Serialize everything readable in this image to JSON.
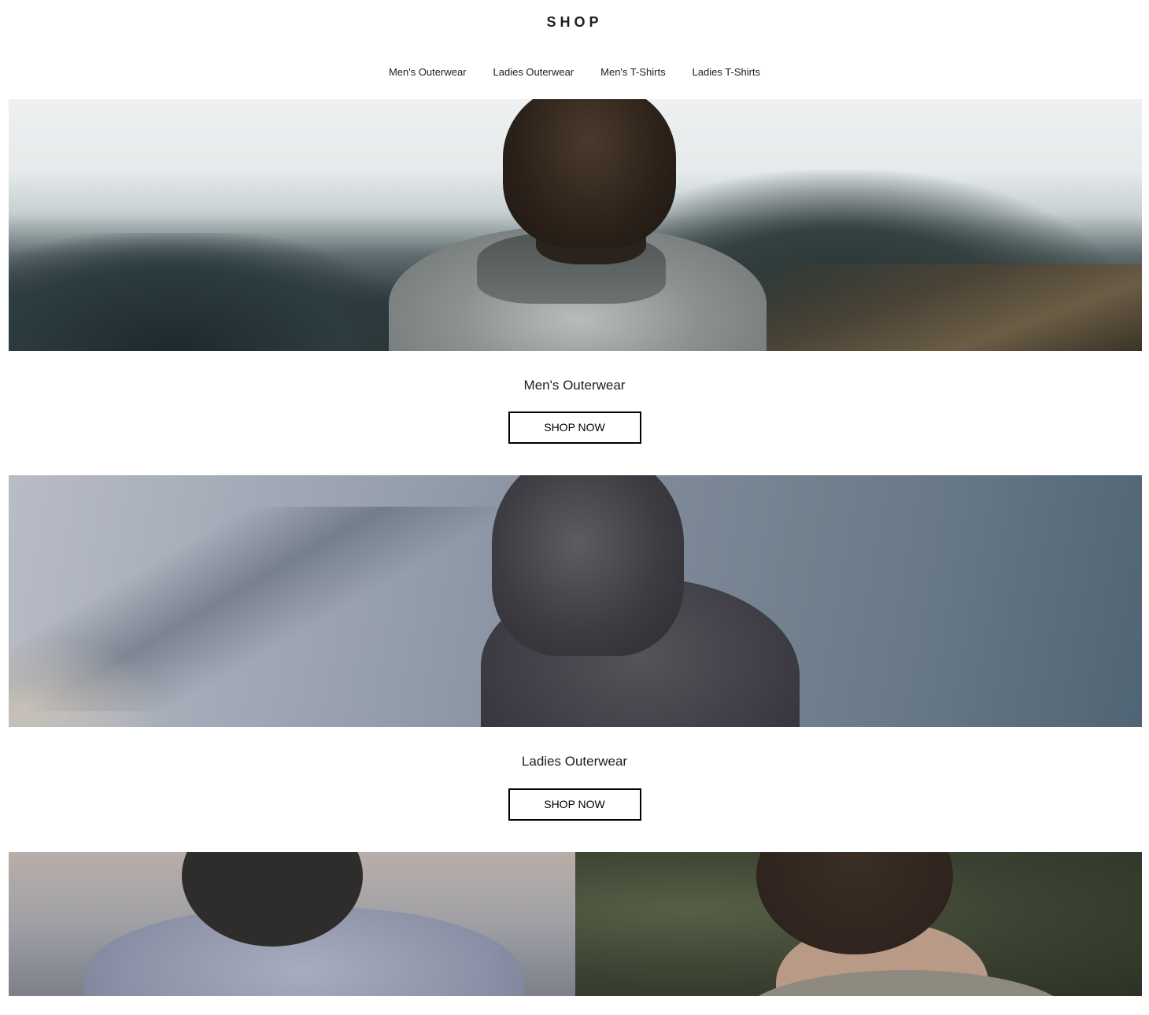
{
  "header": {
    "logo": "SHOP",
    "nav": [
      {
        "label": "Men's Outerwear"
      },
      {
        "label": "Ladies Outerwear"
      },
      {
        "label": "Men's T-Shirts"
      },
      {
        "label": "Ladies T-Shirts"
      }
    ]
  },
  "categories": [
    {
      "title": "Men's Outerwear",
      "button_label": "SHOP NOW"
    },
    {
      "title": "Ladies Outerwear",
      "button_label": "SHOP NOW"
    }
  ],
  "colors": {
    "text": "#202020",
    "button_border": "#000000",
    "background": "#ffffff"
  }
}
